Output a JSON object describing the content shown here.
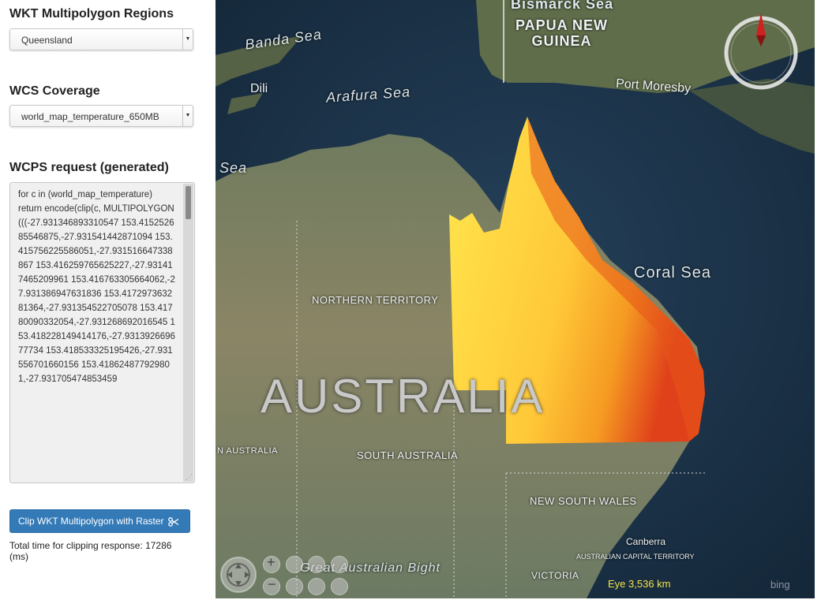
{
  "sidebar": {
    "regions_title": "WKT Multipolygon Regions",
    "region_selected": "Queensland",
    "coverage_title": "WCS Coverage",
    "coverage_selected": "world_map_temperature_650MB",
    "wcps_title": "WCPS request (generated)",
    "wcps_text": "for c in (world_map_temperature)\nreturn encode(clip(c, MULTIPOLYGON(((-27.931346893310547 153.415252685546875,-27.931541442871094 153.415756225586051,-27.931516647338867 153.416259765625227,-27.931417465209961 153.416763305664062,-27.931386947631836 153.417297363281364,-27.931354522705078 153.41780090332054,-27.931268692016545 153.418228149414176,-27.931392669677734 153.418533325195426,-27.931556701660156 153.418624877929801,-27.931705474853459",
    "clip_button_label": "Clip WKT Multipolygon with Raster",
    "timing_text": "Total time for clipping response: 17286 (ms)"
  },
  "icons": {
    "dropdown": "caret-down-icon",
    "clip": "scissors-icon",
    "compass": "compass-icon",
    "pan": "pan-icon",
    "zoom_in": "zoom-in-icon",
    "zoom_out": "zoom-out-icon",
    "bing": "bing-logo"
  },
  "map": {
    "labels": {
      "bismarck_sea": "Bismarck Sea",
      "banda_sea": "Banda Sea",
      "papua_new_guinea": "PAPUA NEW\nGUINEA",
      "dili": "Dili",
      "port_moresby": "Port Moresby",
      "arafura_sea": "Arafura Sea",
      "sea_left": "Sea",
      "coral_sea": "Coral Sea",
      "northern_territory": "NORTHERN TERRITORY",
      "australia": "AUSTRALIA",
      "south_australia": "SOUTH AUSTRALIA",
      "w_australia": "N AUSTRALIA",
      "new_south_wales": "NEW SOUTH WALES",
      "canberra": "Canberra",
      "act": "AUSTRALIAN CAPITAL TERRITORY",
      "great_bight": "Great Australian Bight",
      "victoria": "VICTORIA"
    },
    "eye_altitude": "Eye  3,536 km",
    "attribution": "bing",
    "colors": {
      "ocean": "#1f3547",
      "land": "#7d8766",
      "raster_low": "#ffe24a",
      "raster_high": "#e03a10"
    }
  }
}
